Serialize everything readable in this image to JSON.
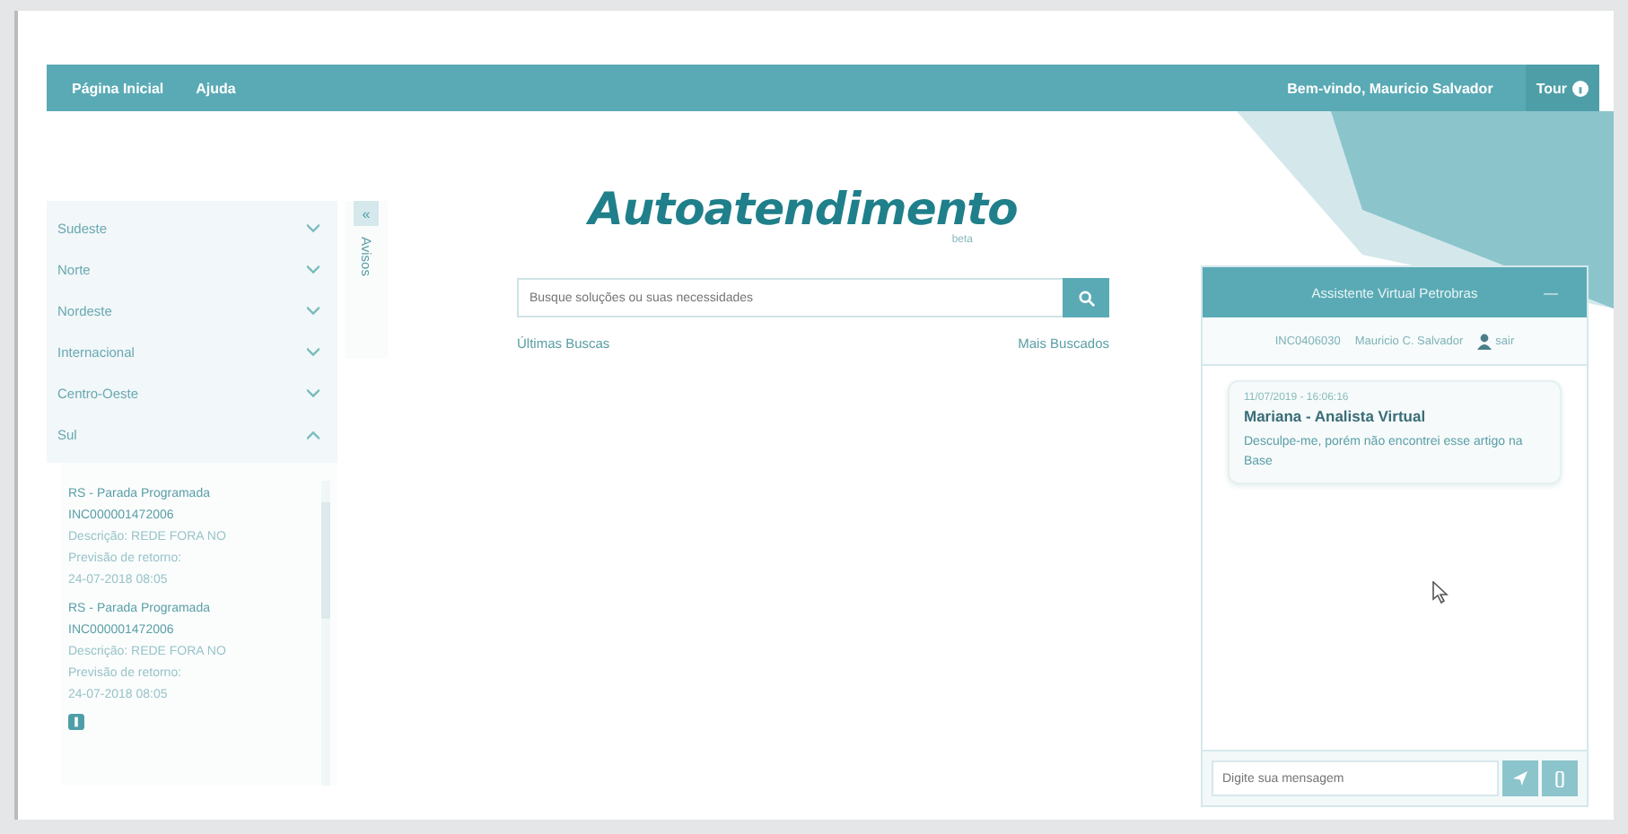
{
  "top_bar": {
    "links": [
      "Página Inicial",
      "Ajuda"
    ],
    "welcome": "Bem-vindo, Mauricio Salvador",
    "tour": "Tour"
  },
  "regions": [
    {
      "label": "Sudeste",
      "expanded": false
    },
    {
      "label": "Norte",
      "expanded": false
    },
    {
      "label": "Nordeste",
      "expanded": false
    },
    {
      "label": "Internacional",
      "expanded": false
    },
    {
      "label": "Centro-Oeste",
      "expanded": false
    },
    {
      "label": "Sul",
      "expanded": true
    }
  ],
  "notices": [
    {
      "title": "RS - Parada Programada INC000001472006",
      "description": "Descrição: REDE FORA NO",
      "return_label": "Previsão de retorno:",
      "return_date": "24-07-2018 08:05"
    },
    {
      "title": "RS - Parada Programada INC000001472006",
      "description": "Descrição: REDE FORA NO",
      "return_label": "Previsão de retorno:",
      "return_date": "24-07-2018 08:05"
    }
  ],
  "avisos_tab": {
    "label": "Avisos",
    "collapse": "«"
  },
  "brand": {
    "title": "Autoatendimento",
    "subtitle": "beta"
  },
  "search": {
    "placeholder": "Busque soluções ou suas necessidades"
  },
  "search_links": [
    "Últimas Buscas",
    "Mais Buscados"
  ],
  "chat": {
    "title": "Assistente Virtual Petrobras",
    "minimize": "—",
    "session": "INC0406030",
    "user": "Mauricio C. Salvador",
    "logout": "sair",
    "messages": [
      {
        "time": "11/07/2019 - 16:06:16",
        "author": "Mariana - Analista Virtual",
        "text": "Desculpe-me, porém não encontrei esse artigo na Base"
      }
    ],
    "input": {
      "placeholder": "Digite sua mensagem"
    }
  }
}
